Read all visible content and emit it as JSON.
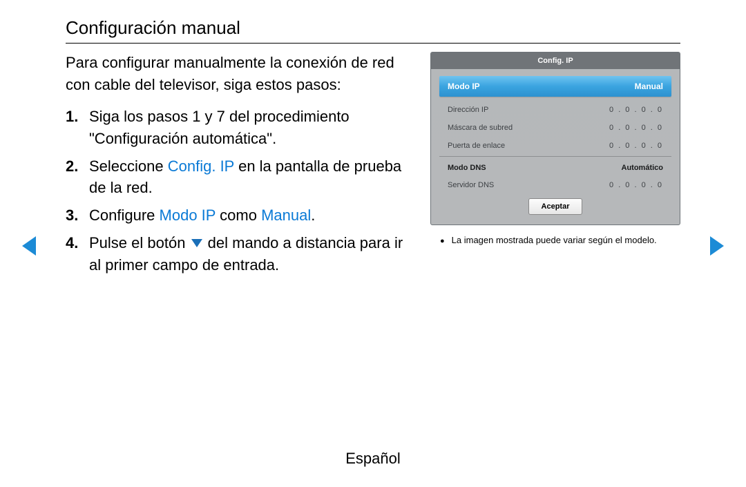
{
  "title": "Configuración manual",
  "intro": "Para configurar manualmente la conexión de red con cable del televisor, siga estos pasos:",
  "steps": {
    "s1_num": "1.",
    "s1_text": "Siga los pasos 1 y 7 del procedimiento \"Configuración automática\".",
    "s2_num": "2.",
    "s2_a": "Seleccione ",
    "s2_hl": "Config. IP",
    "s2_b": " en la pantalla de prueba de la red.",
    "s3_num": "3.",
    "s3_a": "Configure ",
    "s3_hl1": "Modo IP",
    "s3_b": " como ",
    "s3_hl2": "Manual",
    "s3_c": ".",
    "s4_num": "4.",
    "s4_a": "Pulse el botón ",
    "s4_b": " del mando a distancia para ir al primer campo de entrada."
  },
  "panel": {
    "title": "Config. IP",
    "modoip_label": "Modo IP",
    "modoip_value": "Manual",
    "dirip_label": "Dirección IP",
    "dirip_value": "0 . 0 . 0 . 0",
    "mask_label": "Máscara de subred",
    "mask_value": "0 . 0 . 0 . 0",
    "gate_label": "Puerta de enlace",
    "gate_value": "0 . 0 . 0 . 0",
    "modons_label": "Modo DNS",
    "modons_value": "Automático",
    "dns_label": "Servidor DNS",
    "dns_value": "0 . 0 . 0 . 0",
    "accept": "Aceptar"
  },
  "note": "La imagen mostrada puede variar según el modelo.",
  "language": "Español"
}
